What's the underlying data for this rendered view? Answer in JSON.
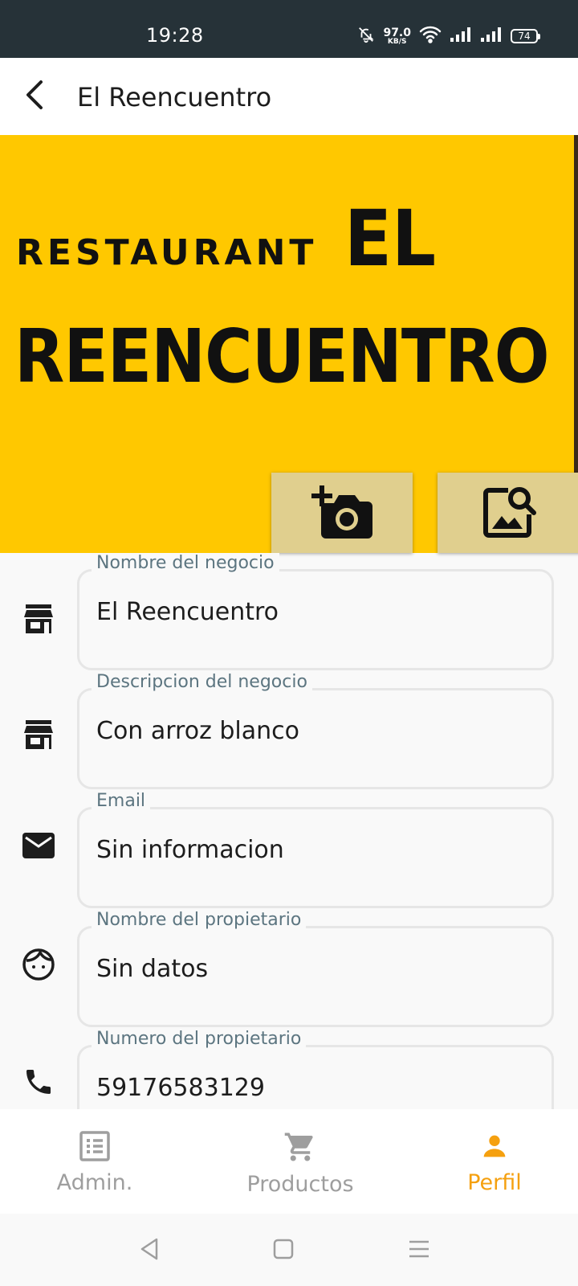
{
  "status_bar": {
    "time": "19:28",
    "net_speed": "97.0",
    "net_unit": "KB/S",
    "battery": "74"
  },
  "app_bar": {
    "title": "El Reencuentro"
  },
  "banner": {
    "line1_small": "RESTAURANT",
    "line1_big": "EL",
    "line2": "REENCUENTRO",
    "background_color": "#ffc800"
  },
  "image_buttons": {
    "camera_icon": "add-a-photo-icon",
    "gallery_icon": "image-search-icon"
  },
  "form": {
    "fields": [
      {
        "label": "Nombre del negocio",
        "value": "El Reencuentro",
        "icon": "store-icon"
      },
      {
        "label": "Descripcion del negocio",
        "value": "Con arroz blanco",
        "icon": "store-icon"
      },
      {
        "label": "Email",
        "value": "Sin informacion",
        "icon": "email-icon"
      },
      {
        "label": "Nombre del propietario",
        "value": "Sin datos",
        "icon": "face-icon"
      },
      {
        "label": "Numero del propietario",
        "value": "59176583129",
        "icon": "phone-icon"
      }
    ]
  },
  "bottom_nav": {
    "items": [
      {
        "label": "Admin.",
        "icon": "list-alt-icon",
        "active": false
      },
      {
        "label": "Productos",
        "icon": "shopping-cart-icon",
        "active": false
      },
      {
        "label": "Perfil",
        "icon": "person-icon",
        "active": true
      }
    ],
    "active_color": "#f5a00f",
    "inactive_color": "#9e9e9e"
  }
}
